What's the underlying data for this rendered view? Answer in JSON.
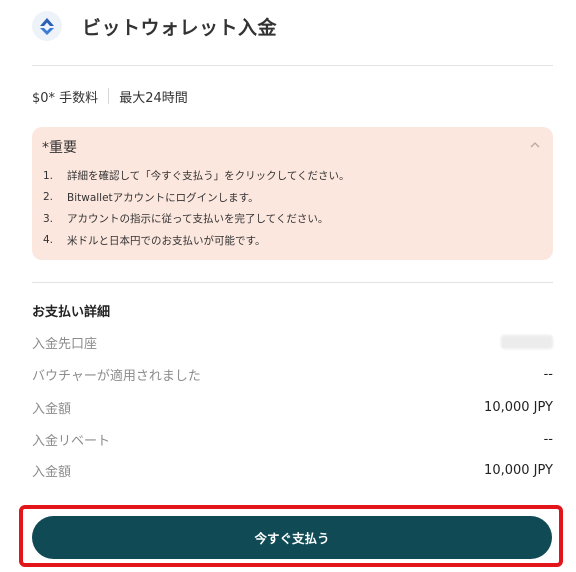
{
  "header": {
    "title": "ビットウォレット入金",
    "logo_icon": "bitwallet-logo-icon"
  },
  "meta": {
    "fee": "$0* 手数料",
    "time": "最大24時間"
  },
  "notice": {
    "title": "*重要",
    "items": [
      {
        "num": "1.",
        "text": "詳細を確認して「今すぐ支払う」をクリックしてください。"
      },
      {
        "num": "2.",
        "text": "Bitwalletアカウントにログインします。"
      },
      {
        "num": "3.",
        "text": "アカウントの指示に従って支払いを完了してください。"
      },
      {
        "num": "4.",
        "text": "米ドルと日本円でのお支払いが可能です。"
      }
    ],
    "background": "#fce7df"
  },
  "details": {
    "title": "お支払い詳細",
    "rows": [
      {
        "label": "入金先口座",
        "value": ""
      },
      {
        "label": "バウチャーが適用されました",
        "value": "--"
      },
      {
        "label": "入金額",
        "value": "10,000 JPY"
      },
      {
        "label": "入金リベート",
        "value": "--"
      },
      {
        "label": "入金額",
        "value": "10,000 JPY"
      }
    ]
  },
  "cta": {
    "label": "今すぐ支払う",
    "color": "#0f4a55",
    "highlight_color": "#e2151b"
  }
}
